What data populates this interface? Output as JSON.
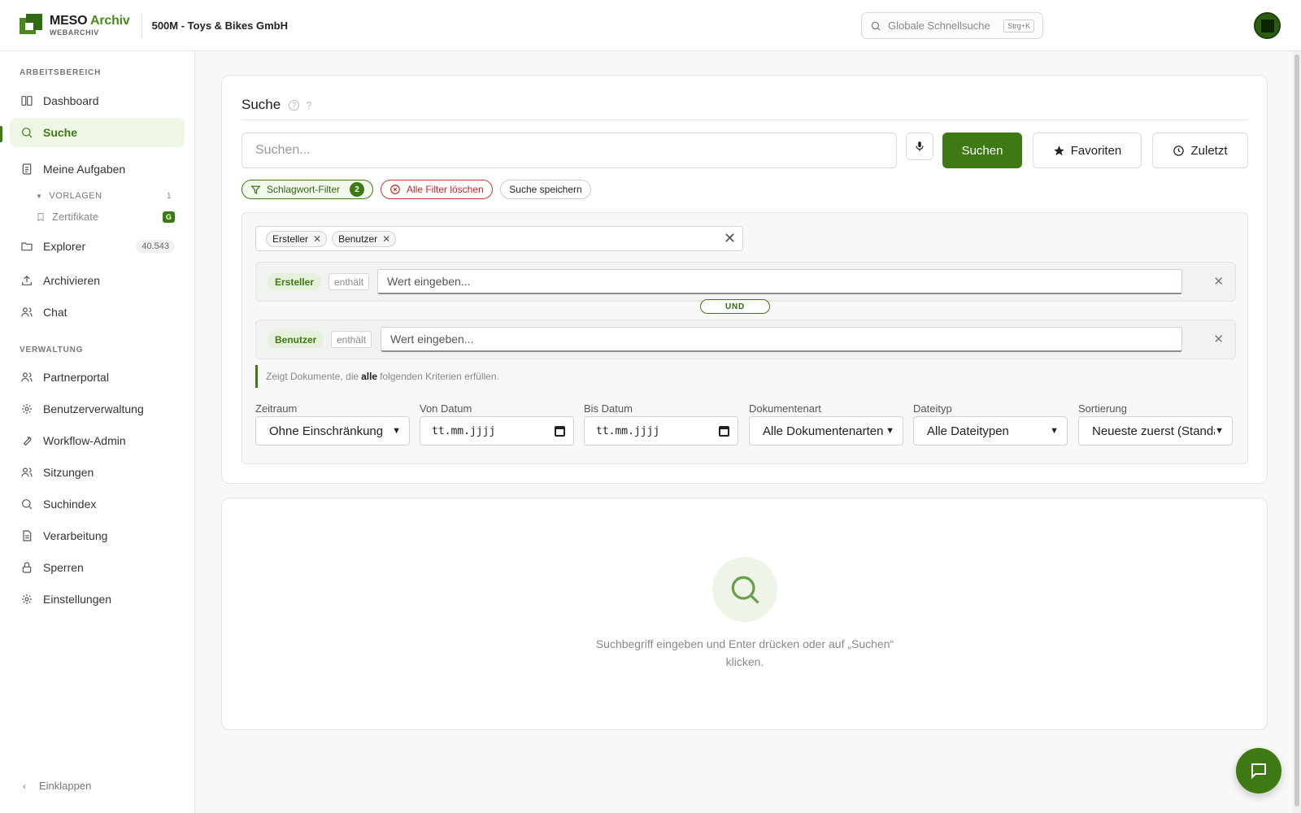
{
  "header": {
    "logo_title_a": "MESO",
    "logo_title_b": "Archiv",
    "logo_sub": "WEBARCHIV",
    "tenant": "500M - Toys & Bikes GmbH",
    "global_search_placeholder": "Globale Schnellsuche",
    "global_search_shortcut": "Strg+K",
    "brand_color": "#3d7a14"
  },
  "sidebar": {
    "section_workspace": "ARBEITSBEREICH",
    "section_admin": "VERWALTUNG",
    "items": {
      "dashboard": "Dashboard",
      "suche": "Suche",
      "aufgaben": "Meine Aufgaben",
      "explorer": "Explorer",
      "explorer_count": "40.543",
      "archivieren": "Archivieren",
      "chat": "Chat",
      "partnerportal": "Partnerportal",
      "benutzerverwaltung": "Benutzerverwaltung",
      "workflow": "Workflow-Admin",
      "sitzungen": "Sitzungen",
      "suchindex": "Suchindex",
      "verarbeitung": "Verarbeitung",
      "sperren": "Sperren",
      "einstellungen": "Einstellungen"
    },
    "vorlagen_label": "VORLAGEN",
    "vorlagen_count": "1",
    "zertifikate": "Zertifikate",
    "zertifikate_badge": "G",
    "collapse": "Einklappen"
  },
  "search": {
    "title": "Suche",
    "help_q": "?",
    "input_placeholder": "Suchen...",
    "btn_search": "Suchen",
    "btn_favorites": "Favoriten",
    "btn_recent": "Zuletzt",
    "chip_filter": "Schlagwort-Filter",
    "chip_filter_count": "2",
    "chip_clear": "Alle Filter löschen",
    "chip_save": "Suche speichern"
  },
  "filters": {
    "tags": [
      "Ersteller",
      "Benutzer"
    ],
    "criteria": [
      {
        "field": "Ersteller",
        "op": "enthält",
        "placeholder": "Wert eingeben..."
      },
      {
        "field": "Benutzer",
        "op": "enthält",
        "placeholder": "Wert eingeben..."
      }
    ],
    "connector": "UND",
    "info_pre": "Zeigt Dokumente, die",
    "info_bold": "alle",
    "info_post": "folgenden Kriterien erfüllen.",
    "controls": [
      {
        "label": "Zeitraum",
        "value": "Ohne Einschränkung"
      },
      {
        "label": "Von Datum",
        "value": "tt.mm.jjjj"
      },
      {
        "label": "Bis Datum",
        "value": "tt.mm.jjjj"
      },
      {
        "label": "Dokumentenart",
        "value": "Alle Dokumentenarten"
      },
      {
        "label": "Dateityp",
        "value": "Alle Dateitypen"
      },
      {
        "label": "Sortierung",
        "value": "Neueste zuerst (Standard)"
      }
    ]
  },
  "results": {
    "empty_line1": "Suchbegriff eingeben und Enter drücken oder auf „Suchen“",
    "empty_line2": "klicken."
  }
}
